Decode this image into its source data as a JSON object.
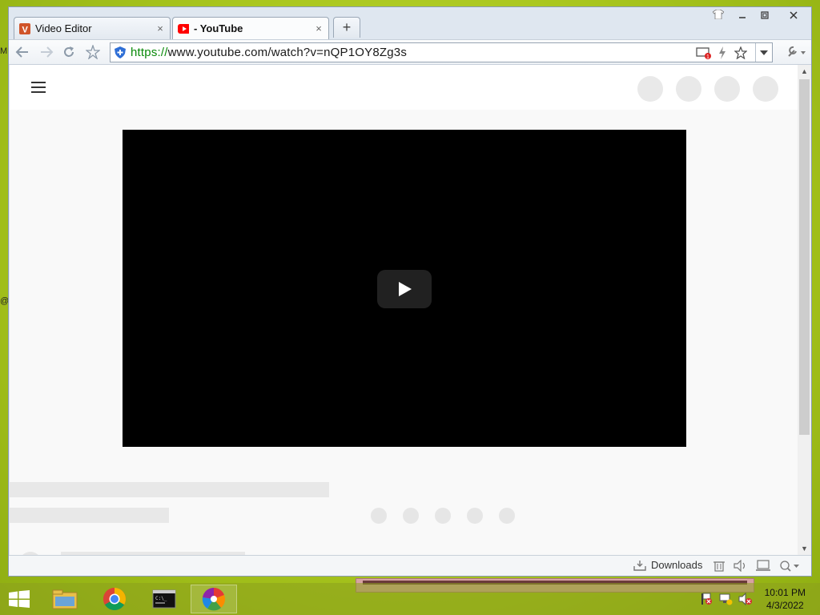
{
  "browser": {
    "tabs": [
      {
        "title": "Video Editor",
        "close": "×",
        "icon": "video-editor-v-icon",
        "active": false
      },
      {
        "title": "- YouTube",
        "close": "×",
        "icon": "youtube-icon",
        "active": true
      }
    ],
    "new_tab": "+",
    "url_scheme": "https://",
    "url_rest": "www.youtube.com/watch?v=nQP1OY8Zg3s"
  },
  "status_bar": {
    "downloads_label": "Downloads"
  },
  "taskbar": {
    "time": "10:01 PM",
    "date": "4/3/2022"
  },
  "colors": {
    "youtube_red": "#ff0000",
    "url_green": "#0a8a0a",
    "desktop_green": "#a9c61e"
  }
}
